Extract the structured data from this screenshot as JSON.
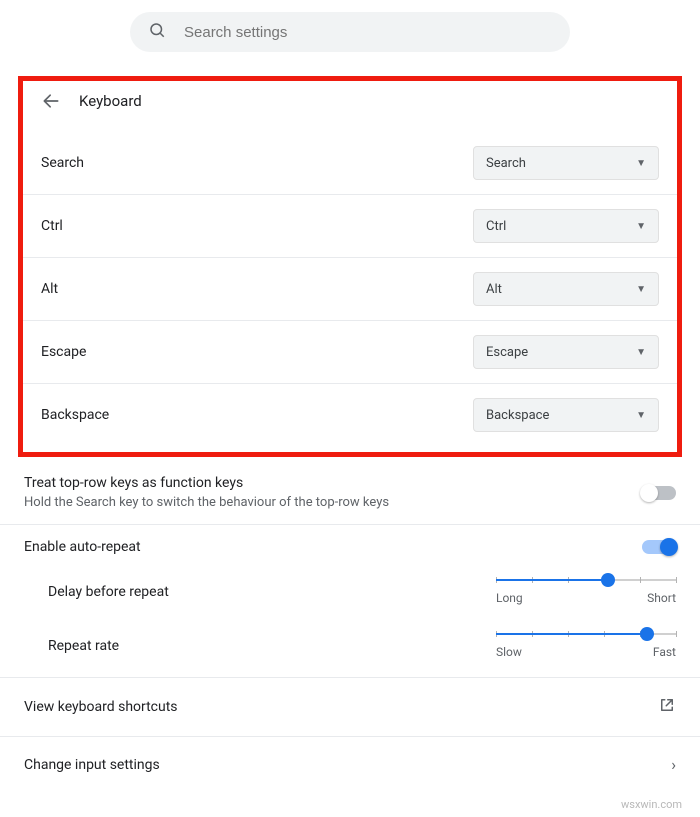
{
  "search": {
    "placeholder": "Search settings"
  },
  "header": {
    "title": "Keyboard"
  },
  "keymap": [
    {
      "label": "Search",
      "value": "Search"
    },
    {
      "label": "Ctrl",
      "value": "Ctrl"
    },
    {
      "label": "Alt",
      "value": "Alt"
    },
    {
      "label": "Escape",
      "value": "Escape"
    },
    {
      "label": "Backspace",
      "value": "Backspace"
    }
  ],
  "topRowKeys": {
    "title": "Treat top-row keys as function keys",
    "subtitle": "Hold the Search key to switch the behaviour of the top-row keys",
    "enabled": false
  },
  "autoRepeat": {
    "title": "Enable auto-repeat",
    "enabled": true,
    "sliders": [
      {
        "label": "Delay before repeat",
        "left": "Long",
        "right": "Short",
        "percent": 62
      },
      {
        "label": "Repeat rate",
        "left": "Slow",
        "right": "Fast",
        "percent": 84
      }
    ]
  },
  "links": {
    "shortcuts": "View keyboard shortcuts",
    "input": "Change input settings"
  },
  "watermark": "wsxwin.com"
}
